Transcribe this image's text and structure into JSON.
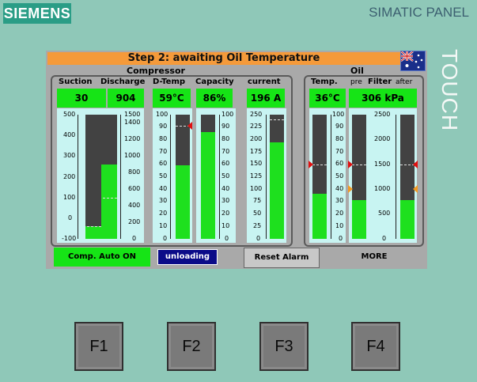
{
  "device": {
    "brand": "SIEMENS",
    "model": "SIMATIC PANEL",
    "touch": "TOUCH"
  },
  "banner": {
    "step_text": "Step 2: awaiting Oil Temperature"
  },
  "flag_icon": "australia-flag-icon",
  "compressor": {
    "title": "Compressor",
    "suction": {
      "label": "Suction",
      "value": "30",
      "scale": [
        "500",
        "400",
        "300",
        "200",
        "100",
        "0",
        "-100"
      ],
      "level": 0.1
    },
    "discharge": {
      "label": "Discharge",
      "value": "904",
      "scale": [
        "1500",
        "1400",
        "1200",
        "1000",
        "800",
        "600",
        "400",
        "200",
        "0"
      ],
      "level": 0.6
    },
    "dtemp": {
      "label": "D-Temp",
      "value": "59°C",
      "scale": [
        "100",
        "90",
        "80",
        "70",
        "60",
        "50",
        "40",
        "30",
        "20",
        "10",
        "0"
      ],
      "level": 0.59
    },
    "capacity": {
      "label": "Capacity",
      "value": "86%",
      "scale": [
        "100",
        "90",
        "80",
        "70",
        "60",
        "50",
        "40",
        "30",
        "20",
        "10",
        "0"
      ],
      "level": 0.86
    },
    "current": {
      "label": "current",
      "value": "196 A",
      "scale": [
        "250",
        "225",
        "200",
        "175",
        "150",
        "125",
        "100",
        "75",
        "50",
        "25",
        "0"
      ],
      "level": 0.78
    }
  },
  "oil": {
    "title": "Oil",
    "temp": {
      "label": "Temp.",
      "value": "36°C",
      "scale": [
        "100",
        "90",
        "80",
        "70",
        "60",
        "50",
        "40",
        "30",
        "20",
        "10",
        "0"
      ],
      "level": 0.36
    },
    "filter": {
      "label": "Filter",
      "pre": "pre",
      "after": "after",
      "value": "306 kPa",
      "scale": [
        "2500",
        "2000",
        "1500",
        "1000",
        "500",
        "0"
      ],
      "level": 0.31
    }
  },
  "controls": {
    "status": "Comp. Auto ON",
    "unloading": "unloading",
    "reset": "Reset Alarm",
    "more": "MORE"
  },
  "fkeys": [
    "F1",
    "F2",
    "F3",
    "F4"
  ],
  "colors": {
    "bezel": "#8fc8b8",
    "value_green": "#16e416",
    "banner_orange": "#f59a3a",
    "alarm_red": "#e01010",
    "warn_orange": "#f39a22"
  }
}
